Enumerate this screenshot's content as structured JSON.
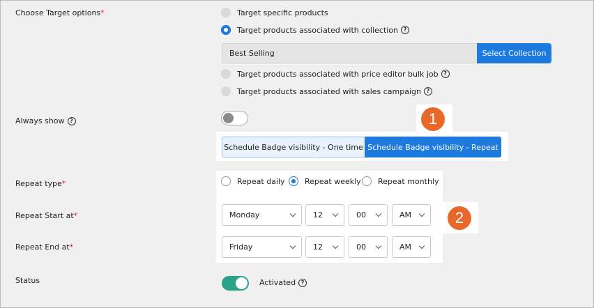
{
  "target_options": {
    "label": "Choose Target options",
    "required_mark": "*",
    "options": [
      {
        "label": "Target specific products",
        "selected": false
      },
      {
        "label": "Target products associated with collection",
        "selected": true,
        "help": "?"
      },
      {
        "label": "Target products associated with price editor bulk job",
        "selected": false,
        "help": "?"
      },
      {
        "label": "Target products associated with sales campaign",
        "selected": false,
        "help": "?"
      }
    ],
    "collection_value": "Best Selling",
    "select_collection_label": "Select Collection"
  },
  "always_show": {
    "label": "Always show",
    "help": "?",
    "enabled": false
  },
  "schedule": {
    "one_time_label": "Schedule Badge visibility - One time",
    "repeat_label": "Schedule Badge visibility - Repeat",
    "active": "repeat"
  },
  "annotations": {
    "badge_1": "1",
    "badge_2": "2"
  },
  "repeat_type": {
    "label": "Repeat type",
    "required_mark": "*",
    "options": [
      {
        "label": "Repeat daily",
        "selected": false
      },
      {
        "label": "Repeat weekly",
        "selected": true
      },
      {
        "label": "Repeat monthly",
        "selected": false
      }
    ]
  },
  "repeat_start": {
    "label": "Repeat Start at",
    "required_mark": "*",
    "day": "Monday",
    "hour": "12",
    "minute": "00",
    "period": "AM"
  },
  "repeat_end": {
    "label": "Repeat End at",
    "required_mark": "*",
    "day": "Friday",
    "hour": "12",
    "minute": "00",
    "period": "AM"
  },
  "status": {
    "label": "Status",
    "state_label": "Activated",
    "help": "?",
    "enabled": true
  },
  "colors": {
    "primary": "#1f7ae0",
    "toggle_on": "#2aa28a",
    "badge": "#e8682a",
    "required": "#e0243a",
    "page_bg": "#f0f0f0"
  }
}
